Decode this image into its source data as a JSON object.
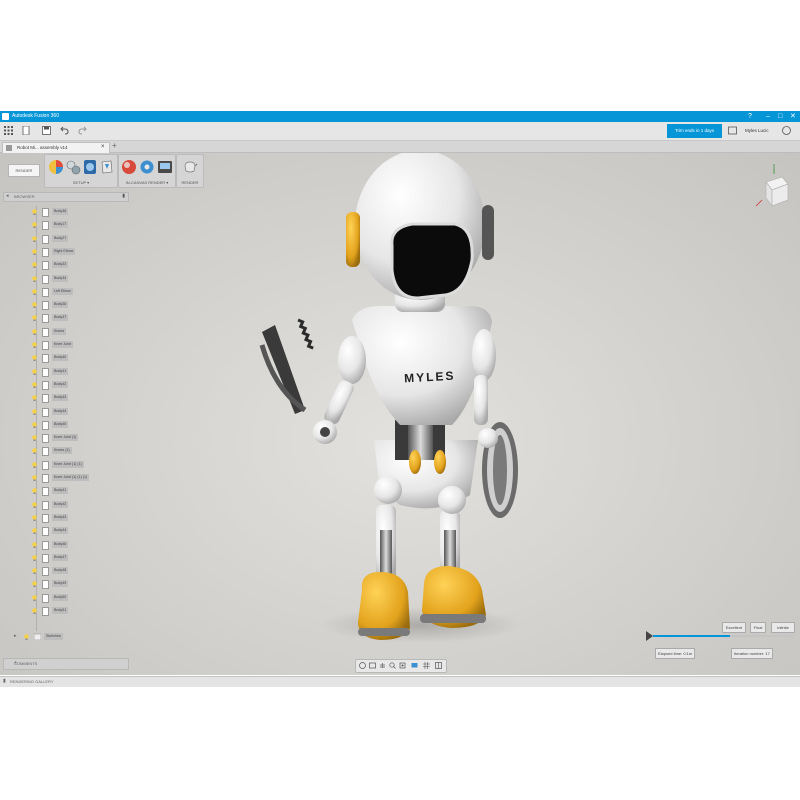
{
  "window": {
    "title": "Autodesk Fusion 360",
    "controls": [
      "?",
      "–",
      "□",
      "✕"
    ]
  },
  "toolbar": {
    "trial_label": "Trim ends in 1 days",
    "user_label": "Myles Lucic"
  },
  "document": {
    "tab_label": "Robot Mi... assembly v14"
  },
  "ribbon": {
    "workspace_label": "RENDER",
    "groups": [
      {
        "label": "SETUP ▾"
      },
      {
        "label": "IN-CANVAS RENDER ▾"
      },
      {
        "label": "RENDER"
      }
    ]
  },
  "browser": {
    "header_label": "BROWSER",
    "items": [
      {
        "label": "Body38"
      },
      {
        "label": "Body17"
      },
      {
        "label": "Body27"
      },
      {
        "label": "Right Elbow"
      },
      {
        "label": "Body33"
      },
      {
        "label": "Body34"
      },
      {
        "label": "Left Elbow"
      },
      {
        "label": "Body36"
      },
      {
        "label": "Body37"
      },
      {
        "label": "Knees"
      },
      {
        "label": "Knee Joint"
      },
      {
        "label": "Body40"
      },
      {
        "label": "Body41"
      },
      {
        "label": "Body42"
      },
      {
        "label": "Body43"
      },
      {
        "label": "Body44"
      },
      {
        "label": "Body45"
      },
      {
        "label": "Knee Joint (1)"
      },
      {
        "label": "Knees (1)"
      },
      {
        "label": "Knee Joint (1) (1)"
      },
      {
        "label": "Knee Joint (1) (1) (1)"
      },
      {
        "label": "Body41"
      },
      {
        "label": "Body42"
      },
      {
        "label": "Body43"
      },
      {
        "label": "Body44"
      },
      {
        "label": "Body46"
      },
      {
        "label": "Body47"
      },
      {
        "label": "Body48"
      },
      {
        "label": "Body49"
      },
      {
        "label": "Body50"
      },
      {
        "label": "Body51"
      }
    ],
    "footer_item": "Sketches"
  },
  "comments": {
    "label": "COMMENTS"
  },
  "gallery": {
    "label": "RENDERING GALLERY"
  },
  "model": {
    "chest_text": "MYLES"
  },
  "render": {
    "quality_buttons": [
      "Excellent",
      "Final",
      "Infinite"
    ],
    "progress": 0.55,
    "elapsed_label": "Elapsed time: 0:1m",
    "iteration_label": "Iteration number: 17"
  },
  "colors": {
    "accent": "#0696d7",
    "robot_white": "#f2f2f2",
    "robot_yellow": "#e8a81e",
    "robot_dark": "#2a2a2a"
  }
}
